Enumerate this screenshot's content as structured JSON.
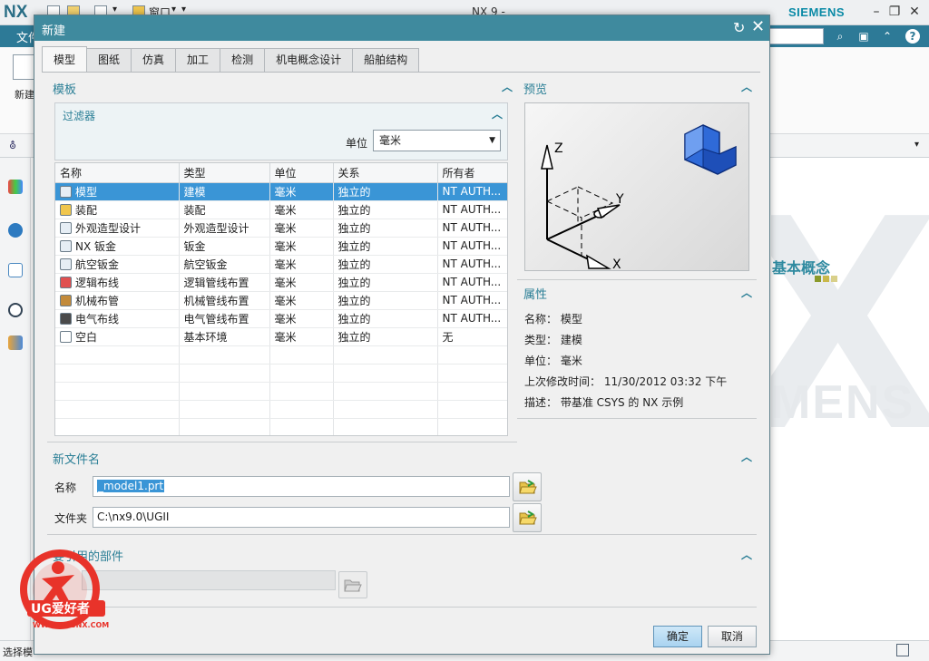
{
  "app": {
    "logo": "NX",
    "title": "NX 9 -",
    "brand": "SIEMENS",
    "menu_window": "窗口",
    "file_tab": "文件",
    "new_label": "新建",
    "status": "选择模",
    "welcome_text": "基本概念",
    "welcome_brand": "MENS"
  },
  "dialog": {
    "title": "新建",
    "tabs": [
      "模型",
      "图纸",
      "仿真",
      "加工",
      "检测",
      "机电概念设计",
      "船舶结构"
    ],
    "active_tab": 0,
    "templates_section": "模板",
    "filter_title": "过滤器",
    "unit_label": "单位",
    "unit_value": "毫米",
    "columns": [
      "名称",
      "类型",
      "单位",
      "关系",
      "所有者"
    ],
    "rows": [
      {
        "name": "模型",
        "type": "建模",
        "unit": "毫米",
        "relation": "独立的",
        "owner": "NT AUTH...",
        "icon": "model-icon"
      },
      {
        "name": "装配",
        "type": "装配",
        "unit": "毫米",
        "relation": "独立的",
        "owner": "NT AUTH...",
        "icon": "assembly-icon"
      },
      {
        "name": "外观造型设计",
        "type": "外观造型设计",
        "unit": "毫米",
        "relation": "独立的",
        "owner": "NT AUTH...",
        "icon": "shape-studio-icon"
      },
      {
        "name": "NX 钣金",
        "type": "钣金",
        "unit": "毫米",
        "relation": "独立的",
        "owner": "NT AUTH...",
        "icon": "sheet-metal-icon"
      },
      {
        "name": "航空钣金",
        "type": "航空钣金",
        "unit": "毫米",
        "relation": "独立的",
        "owner": "NT AUTH...",
        "icon": "aero-sheet-metal-icon"
      },
      {
        "name": "逻辑布线",
        "type": "逻辑管线布置",
        "unit": "毫米",
        "relation": "独立的",
        "owner": "NT AUTH...",
        "icon": "logical-routing-icon"
      },
      {
        "name": "机械布管",
        "type": "机械管线布置",
        "unit": "毫米",
        "relation": "独立的",
        "owner": "NT AUTH...",
        "icon": "mechanical-piping-icon"
      },
      {
        "name": "电气布线",
        "type": "电气管线布置",
        "unit": "毫米",
        "relation": "独立的",
        "owner": "NT AUTH...",
        "icon": "electrical-routing-icon"
      },
      {
        "name": "空白",
        "type": "基本环境",
        "unit": "毫米",
        "relation": "独立的",
        "owner": "无",
        "icon": "blank-icon"
      }
    ],
    "selected_row": 0,
    "preview_section": "预览",
    "properties_section": "属性",
    "props": {
      "name": "名称： 模型",
      "type": "类型： 建模",
      "unit": "单位： 毫米",
      "modified": "上次修改时间： 11/30/2012 03:32 下午",
      "desc": "描述： 带基准 CSYS 的 NX 示例"
    },
    "new_file_section": "新文件名",
    "name_label": "名称",
    "name_value": "_model1.prt",
    "folder_label": "文件夹",
    "folder_value": "C:\\nx9.0\\UGII",
    "ref_section": "要引用的部件",
    "ok": "确定",
    "cancel": "取消"
  },
  "watermark": {
    "brand": "UG爱好者",
    "url": "WWW.UGSNX.COM"
  },
  "colors": {
    "title_bar": "#3f8a9e",
    "accent_text": "#2b7f96",
    "selection": "#3a95d6"
  }
}
